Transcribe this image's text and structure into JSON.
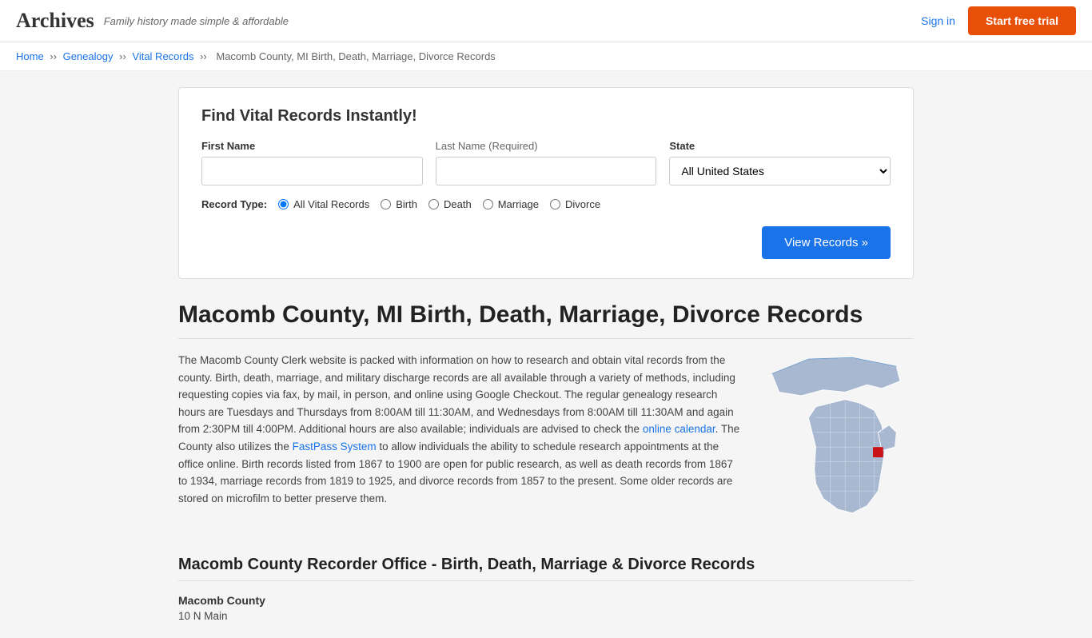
{
  "header": {
    "logo": "Archives",
    "tagline": "Family history made simple & affordable",
    "sign_in": "Sign in",
    "start_trial": "Start free trial"
  },
  "breadcrumb": {
    "home": "Home",
    "genealogy": "Genealogy",
    "vital_records": "Vital Records",
    "current": "Macomb County, MI Birth, Death, Marriage, Divorce Records"
  },
  "search": {
    "title": "Find Vital Records Instantly!",
    "first_name_label": "First Name",
    "last_name_label": "Last Name",
    "last_name_required": "(Required)",
    "state_label": "State",
    "state_default": "All United States",
    "record_type_label": "Record Type:",
    "record_types": [
      "All Vital Records",
      "Birth",
      "Death",
      "Marriage",
      "Divorce"
    ],
    "view_records_btn": "View Records »"
  },
  "page": {
    "title": "Macomb County, MI Birth, Death, Marriage, Divorce Records",
    "body": "The Macomb County Clerk website is packed with information on how to research and obtain vital records from the county. Birth, death, marriage, and military discharge records are all available through a variety of methods, including requesting copies via fax, by mail, in person, and online using Google Checkout. The regular genealogy research hours are Tuesdays and Thursdays from 8:00AM till 11:30AM, and Wednesdays from 8:00AM till 11:30AM and again from 2:30PM till 4:00PM. Additional hours are also available; individuals are advised to check the ",
    "link1": "online calendar",
    "body2": ". The County also utilizes the ",
    "link2": "FastPass System",
    "body3": " to allow individuals the ability to schedule research appointments at the office online. Birth records listed from 1867 to 1900 are open for public research, as well as death records from 1867 to 1934, marriage records from 1819 to 1925, and divorce records from 1857 to the present. Some older records are stored on microfilm to better preserve them.",
    "section2_title": "Macomb County Recorder Office - Birth, Death, Marriage & Divorce Records",
    "county_name": "Macomb County",
    "address": "10 N Main"
  }
}
